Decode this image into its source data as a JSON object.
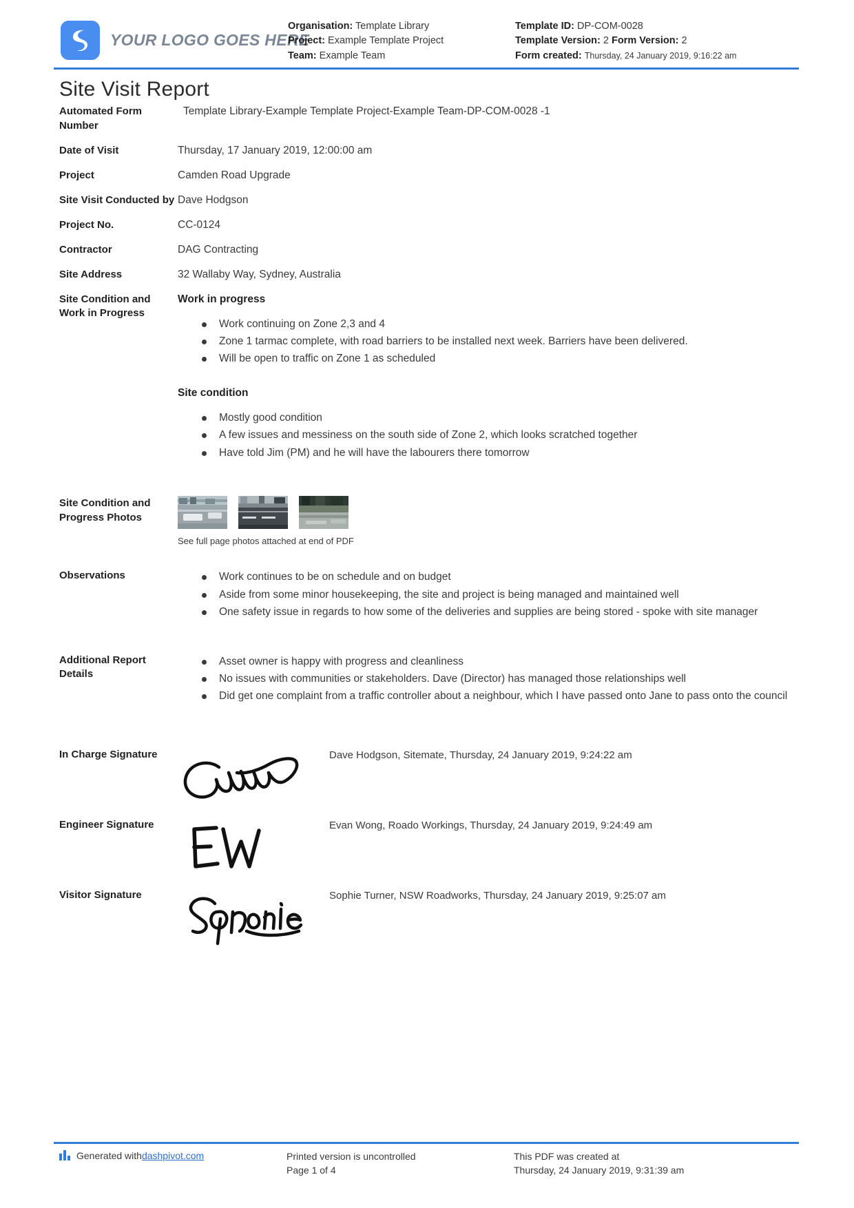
{
  "header": {
    "logo_text": "YOUR LOGO GOES HERE",
    "logo_icon": "dashpivot-logo-icon",
    "organisation_label": "Organisation:",
    "organisation_value": "Template Library",
    "project_label": "Project:",
    "project_value": "Example Template Project",
    "team_label": "Team:",
    "team_value": "Example Team",
    "template_id_label": "Template ID:",
    "template_id_value": "DP-COM-0028",
    "template_version_label": "Template Version:",
    "template_version_value": "2",
    "form_version_label": "Form Version:",
    "form_version_value": "2",
    "form_created_label": "Form created:",
    "form_created_value": "Thursday, 24 January 2019, 9:16:22 am"
  },
  "title": "Site Visit Report",
  "fields": {
    "automated_form_number_label": "Automated Form Number",
    "automated_form_number_value": "Template Library-Example Template Project-Example Team-DP-COM-0028   -1",
    "date_of_visit_label": "Date of Visit",
    "date_of_visit_value": "Thursday, 17 January 2019, 12:00:00 am",
    "project_label": "Project",
    "project_value": "Camden Road Upgrade",
    "conducted_by_label": "Site Visit Conducted by",
    "conducted_by_value": "Dave Hodgson",
    "project_no_label": "Project No.",
    "project_no_value": "CC-0124",
    "contractor_label": "Contractor",
    "contractor_value": "DAG Contracting",
    "site_address_label": "Site Address",
    "site_address_value": "32 Wallaby Way, Sydney, Australia",
    "site_condition_work_label": "Site Condition and Work in Progress",
    "photos_label": "Site Condition and Progress Photos",
    "observations_label": "Observations",
    "additional_label": "Additional Report Details"
  },
  "work_in_progress": {
    "heading": "Work in progress",
    "items": [
      "Work continuing on Zone 2,3 and 4",
      "Zone 1 tarmac complete, with road barriers to be installed next week. Barriers have been delivered.",
      "Will be open to traffic on Zone 1 as scheduled"
    ]
  },
  "site_condition": {
    "heading": "Site condition",
    "items": [
      "Mostly good condition",
      "A few issues and messiness on the south side of Zone 2, which looks scratched together",
      "Have told Jim (PM) and he will have the labourers there tomorrow"
    ]
  },
  "photos": {
    "caption": "See full page photos attached at end of PDF",
    "thumbnails": [
      "site-photo-road-kerb",
      "site-photo-road-works",
      "site-photo-roadside-vegetation"
    ]
  },
  "observations": {
    "items": [
      "Work continues to be on schedule and on budget",
      "Aside from some minor housekeeping, the site and project is being managed and maintained well",
      "One safety issue in regards to how some of the deliveries and supplies are being stored - spoke with site manager"
    ]
  },
  "additional_details": {
    "items": [
      "Asset owner is happy with progress and cleanliness",
      "No issues with communities or stakeholders. Dave (Director) has managed those relationships well",
      "Did get one complaint from a traffic controller about a neighbour, which I have passed onto Jane to pass onto the council"
    ]
  },
  "signatures": [
    {
      "label": "In Charge Signature",
      "glyph": "Camm",
      "meta": "Dave Hodgson, Sitemate, Thursday, 24 January 2019, 9:24:22 am"
    },
    {
      "label": "Engineer Signature",
      "glyph": "EW",
      "meta": "Evan Wong, Roado Workings, Thursday, 24 January 2019, 9:24:49 am"
    },
    {
      "label": "Visitor Signature",
      "glyph": "Sophie",
      "meta": "Sophie Turner, NSW Roadworks, Thursday, 24 January 2019, 9:25:07 am"
    }
  ],
  "footer": {
    "generated_prefix": "Generated with ",
    "generated_link": "dashpivot.com",
    "uncontrolled": "Printed version is uncontrolled",
    "page_number": "Page 1 of 4",
    "created_line1": "This PDF was created at",
    "created_line2": "Thursday, 24 January 2019, 9:31:39 am"
  },
  "colors": {
    "accent": "#2f7ed8",
    "logo": "#4a8df0",
    "link": "#2f6fd0"
  }
}
